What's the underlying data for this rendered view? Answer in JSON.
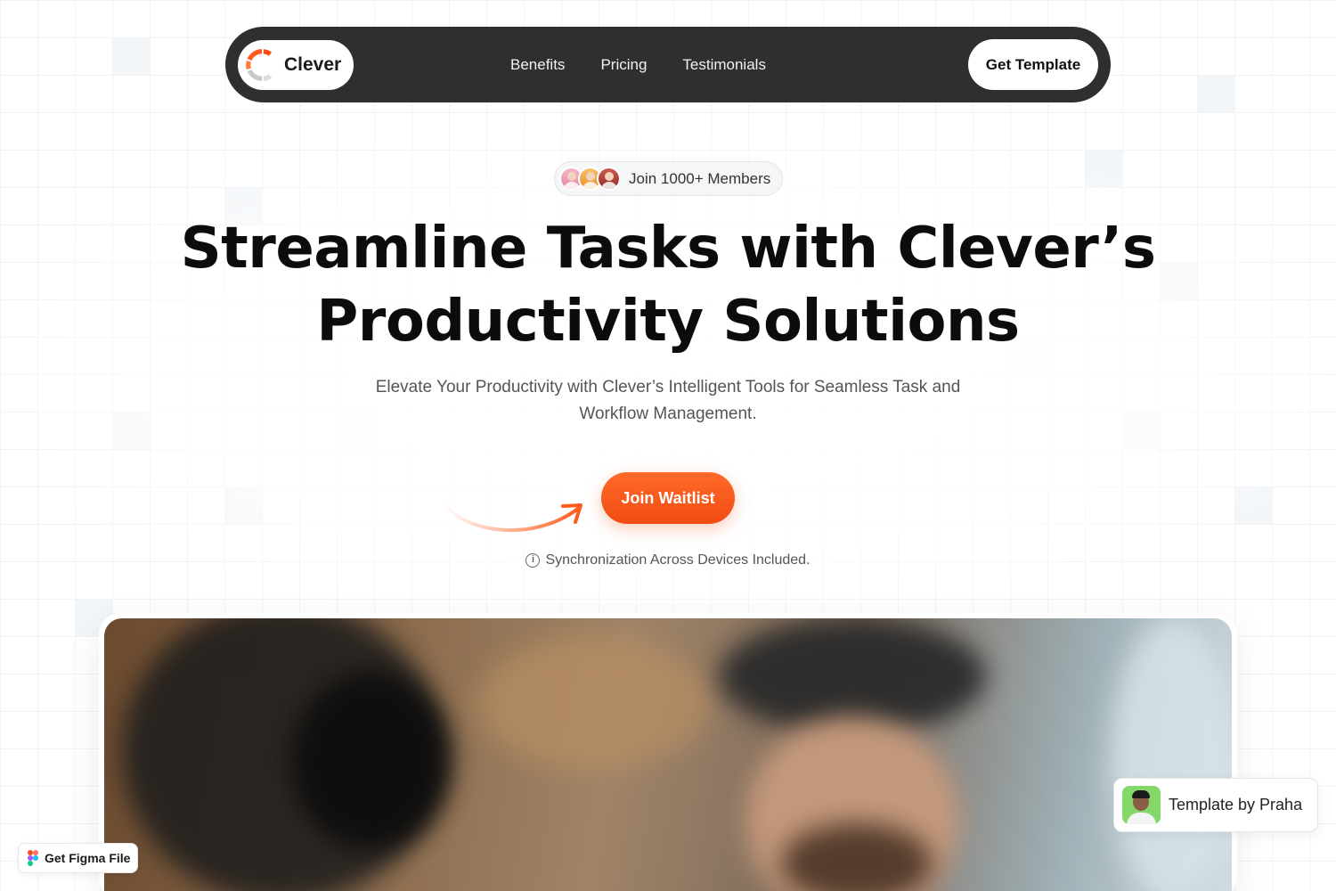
{
  "brand": {
    "name": "Clever",
    "accent": "#F2571A"
  },
  "nav": {
    "links": [
      "Benefits",
      "Pricing",
      "Testimonials"
    ],
    "cta_label": "Get Template"
  },
  "hero": {
    "members_label": "Join 1000+ Members",
    "headline_line1": "Streamline Tasks with Clever’s",
    "headline_line2": "Productivity Solutions",
    "subline": "Elevate Your Productivity with Clever’s Intelligent Tools for Seamless Task and Workflow Management.",
    "cta_label": "Join Waitlist",
    "note": "Synchronization Across Devices Included."
  },
  "badges": {
    "template_by": "Template by Praha",
    "figma_label": "Get Figma File"
  },
  "icons": {
    "info": "info-icon",
    "arrow": "curved-arrow-icon",
    "logo": "clever-logo-icon",
    "figma": "figma-icon"
  }
}
